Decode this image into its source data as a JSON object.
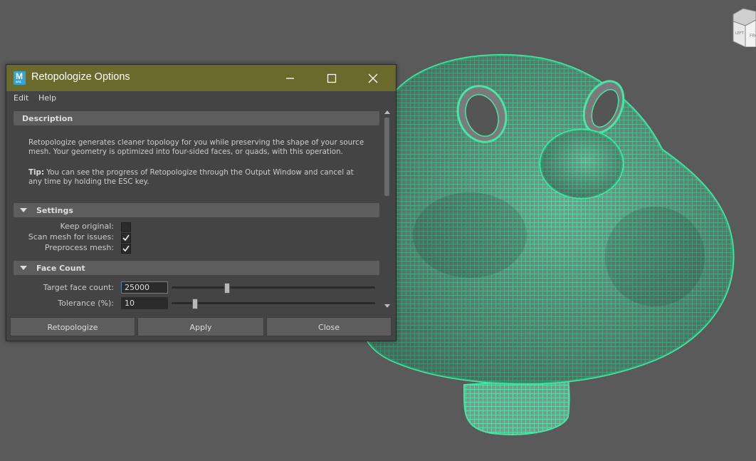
{
  "window": {
    "title": "Retopologize Options",
    "app_icon_letter": "M",
    "app_icon_sub": "AYA"
  },
  "menu": [
    "Edit",
    "Help"
  ],
  "description": {
    "header": "Description",
    "text_1": "Retopologize generates cleaner topology for you while preserving the shape of your source",
    "text_2": "mesh. Your geometry is optimized into four-sided faces, or quads, with this operation.",
    "tip_label": "Tip:",
    "tip_text_1": " You can see the progress of Retopologize through the Output Window and cancel at",
    "tip_text_2": "any time by holding the ESC key."
  },
  "settings": {
    "header": "Settings",
    "keep_original_label": "Keep original:",
    "keep_original": false,
    "scan_mesh_label": "Scan mesh for issues:",
    "scan_mesh": true,
    "preprocess_label": "Preprocess mesh:",
    "preprocess": true
  },
  "face_count": {
    "header": "Face Count",
    "target_label": "Target face count:",
    "target_value": "25000",
    "target_slider_fraction": 0.26,
    "tolerance_label": "Tolerance (%):",
    "tolerance_value": "10",
    "tolerance_slider_fraction": 0.1
  },
  "buttons": {
    "retopologize": "Retopologize",
    "apply": "Apply",
    "close": "Close"
  },
  "view_cube_labels": [
    "LEFT",
    "FRONT"
  ],
  "colors": {
    "mesh_wire": "#48e6a4",
    "title_bar": "#6a6a2d",
    "viewport_bg": "#5a5a5a"
  }
}
